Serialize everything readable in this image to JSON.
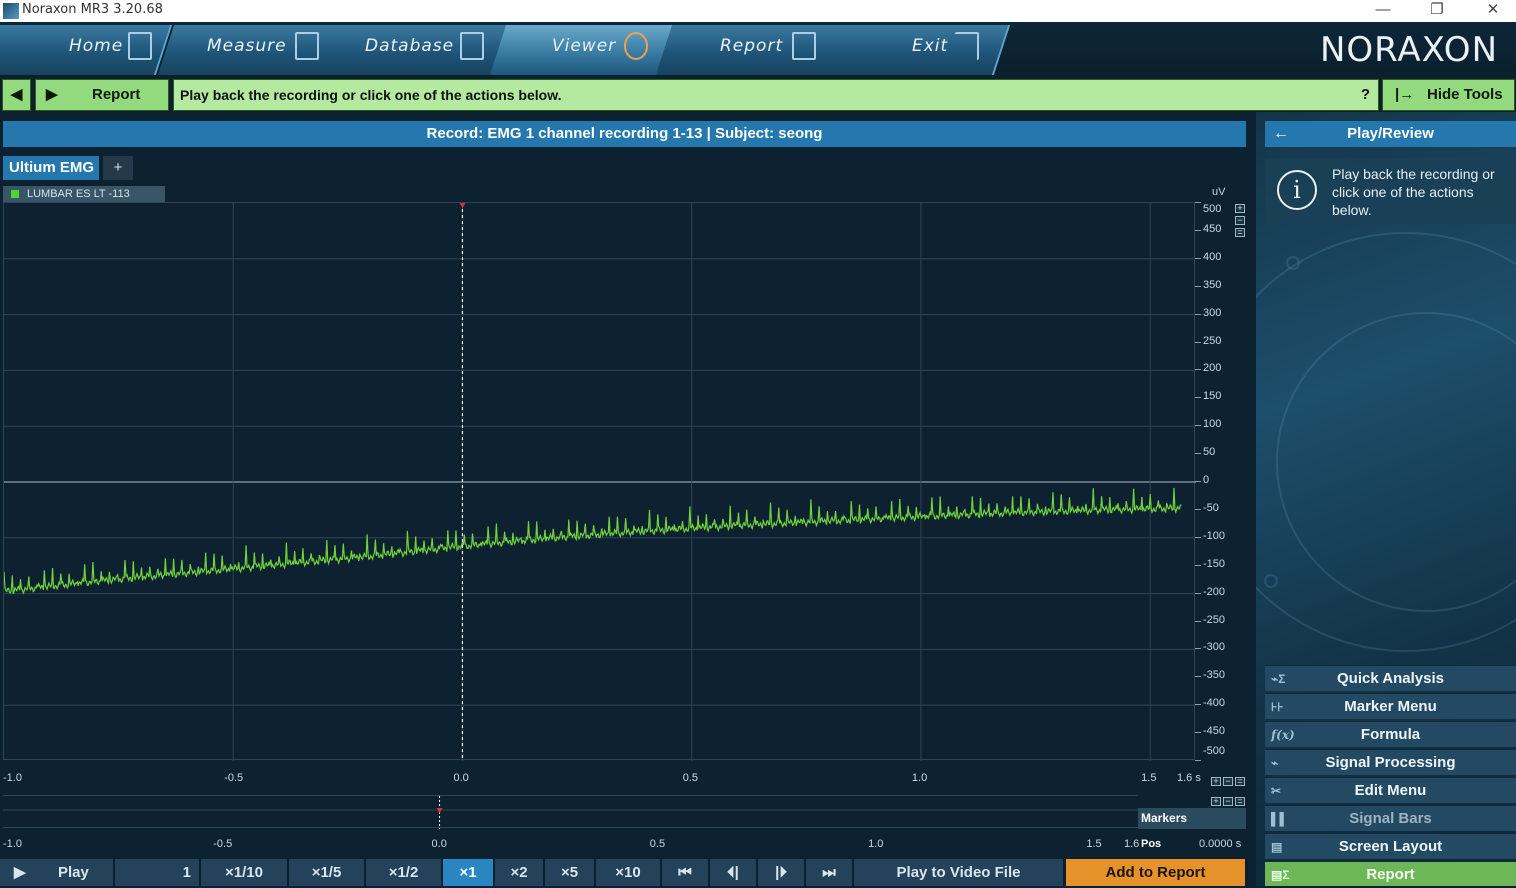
{
  "window": {
    "title": "Noraxon MR3 3.20.68",
    "minimize": "—",
    "restore": "❐",
    "close": "✕"
  },
  "nav": {
    "tabs": [
      {
        "label": "Home",
        "icon": "home-icon"
      },
      {
        "label": "Measure",
        "icon": "measure-icon"
      },
      {
        "label": "Database",
        "icon": "database-icon"
      },
      {
        "label": "Viewer",
        "icon": "viewer-icon",
        "active": true
      },
      {
        "label": "Report",
        "icon": "report-icon"
      },
      {
        "label": "Exit",
        "icon": "exit-icon"
      }
    ],
    "logo": "NORAXON"
  },
  "toolbar": {
    "prev_icon": "◀",
    "next_icon": "▶",
    "report_label": "Report",
    "hint": "Play back the recording or click one of the actions below.",
    "help": "?",
    "hide_tools_label": "Hide Tools",
    "hide_tools_icon": "|→"
  },
  "record": {
    "title": "Record: EMG 1 channel recording 1-13 | Subject: seong"
  },
  "chart_tabs": {
    "active": "Ultium EMG",
    "add": "+"
  },
  "channel": {
    "label": "LUMBAR ES LT   -113",
    "color": "#4fd23a"
  },
  "chart_data": {
    "type": "line",
    "title": "",
    "ylabel": "uV",
    "xunit": "s",
    "xlim": [
      -1.0,
      1.6
    ],
    "ylim": [
      -500,
      500
    ],
    "yticks": [
      500,
      450,
      400,
      350,
      300,
      250,
      200,
      150,
      100,
      50,
      0,
      -50,
      -100,
      -150,
      -200,
      -250,
      -300,
      -350,
      -400,
      -450,
      -500
    ],
    "xticks": [
      "-1.0",
      "-0.5",
      "0.0",
      "0.5",
      "1.0",
      "1.5"
    ],
    "x_end_label": "1.6 s",
    "cursor_x": 0.0,
    "grid": true,
    "series": [
      {
        "color": "#6fd33a",
        "x": [
          -1.0,
          -0.8,
          -0.6,
          -0.4,
          -0.2,
          0.0,
          0.2,
          0.4,
          0.6,
          0.8,
          1.0,
          1.2,
          1.4,
          1.57
        ],
        "y": [
          -196,
          -178,
          -163,
          -148,
          -133,
          -115,
          -100,
          -88,
          -78,
          -70,
          -62,
          -55,
          -50,
          -47
        ],
        "spike_amplitude": 35
      }
    ]
  },
  "markers": {
    "label": "Markers",
    "pos_label": "Pos",
    "pos_value": "0.0000 s",
    "xticks": [
      "-1.0",
      "-0.5",
      "0.0",
      "0.5",
      "1.0",
      "1.5"
    ],
    "x_end_label": "1.6"
  },
  "playback": {
    "play_label": "Play",
    "frame": "1",
    "speeds": [
      "×1/10",
      "×1/5",
      "×1/2",
      "×1",
      "×2",
      "×5",
      "×10"
    ],
    "selected_speed": "×1",
    "first_icon": "⏮",
    "prev_icon": "⏴|",
    "next_icon": "|⏵",
    "last_icon": "⏭",
    "play_to_video": "Play to Video File",
    "add_to_report": "Add to Report"
  },
  "right_panel": {
    "title": "Play/Review",
    "back_icon": "←",
    "info_text": "Play back the recording or click one of the actions below.",
    "info_icon": "i",
    "actions": [
      {
        "label": "Quick Analysis",
        "icon": "quick-analysis-icon",
        "glyph": "⌁Σ"
      },
      {
        "label": "Marker Menu",
        "icon": "marker-menu-icon",
        "glyph": "⊦⊦"
      },
      {
        "label": "Formula",
        "icon": "formula-icon",
        "glyph": "f(x)"
      },
      {
        "label": "Signal Processing",
        "icon": "signal-processing-icon",
        "glyph": "⌁"
      },
      {
        "label": "Edit Menu",
        "icon": "edit-menu-icon",
        "glyph": "✂"
      },
      {
        "label": "Signal Bars",
        "icon": "signal-bars-icon",
        "glyph": "▌▌"
      },
      {
        "label": "Screen Layout",
        "icon": "screen-layout-icon",
        "glyph": "▤"
      },
      {
        "label": "Report",
        "icon": "report-icon",
        "glyph": "▤Σ"
      }
    ]
  }
}
